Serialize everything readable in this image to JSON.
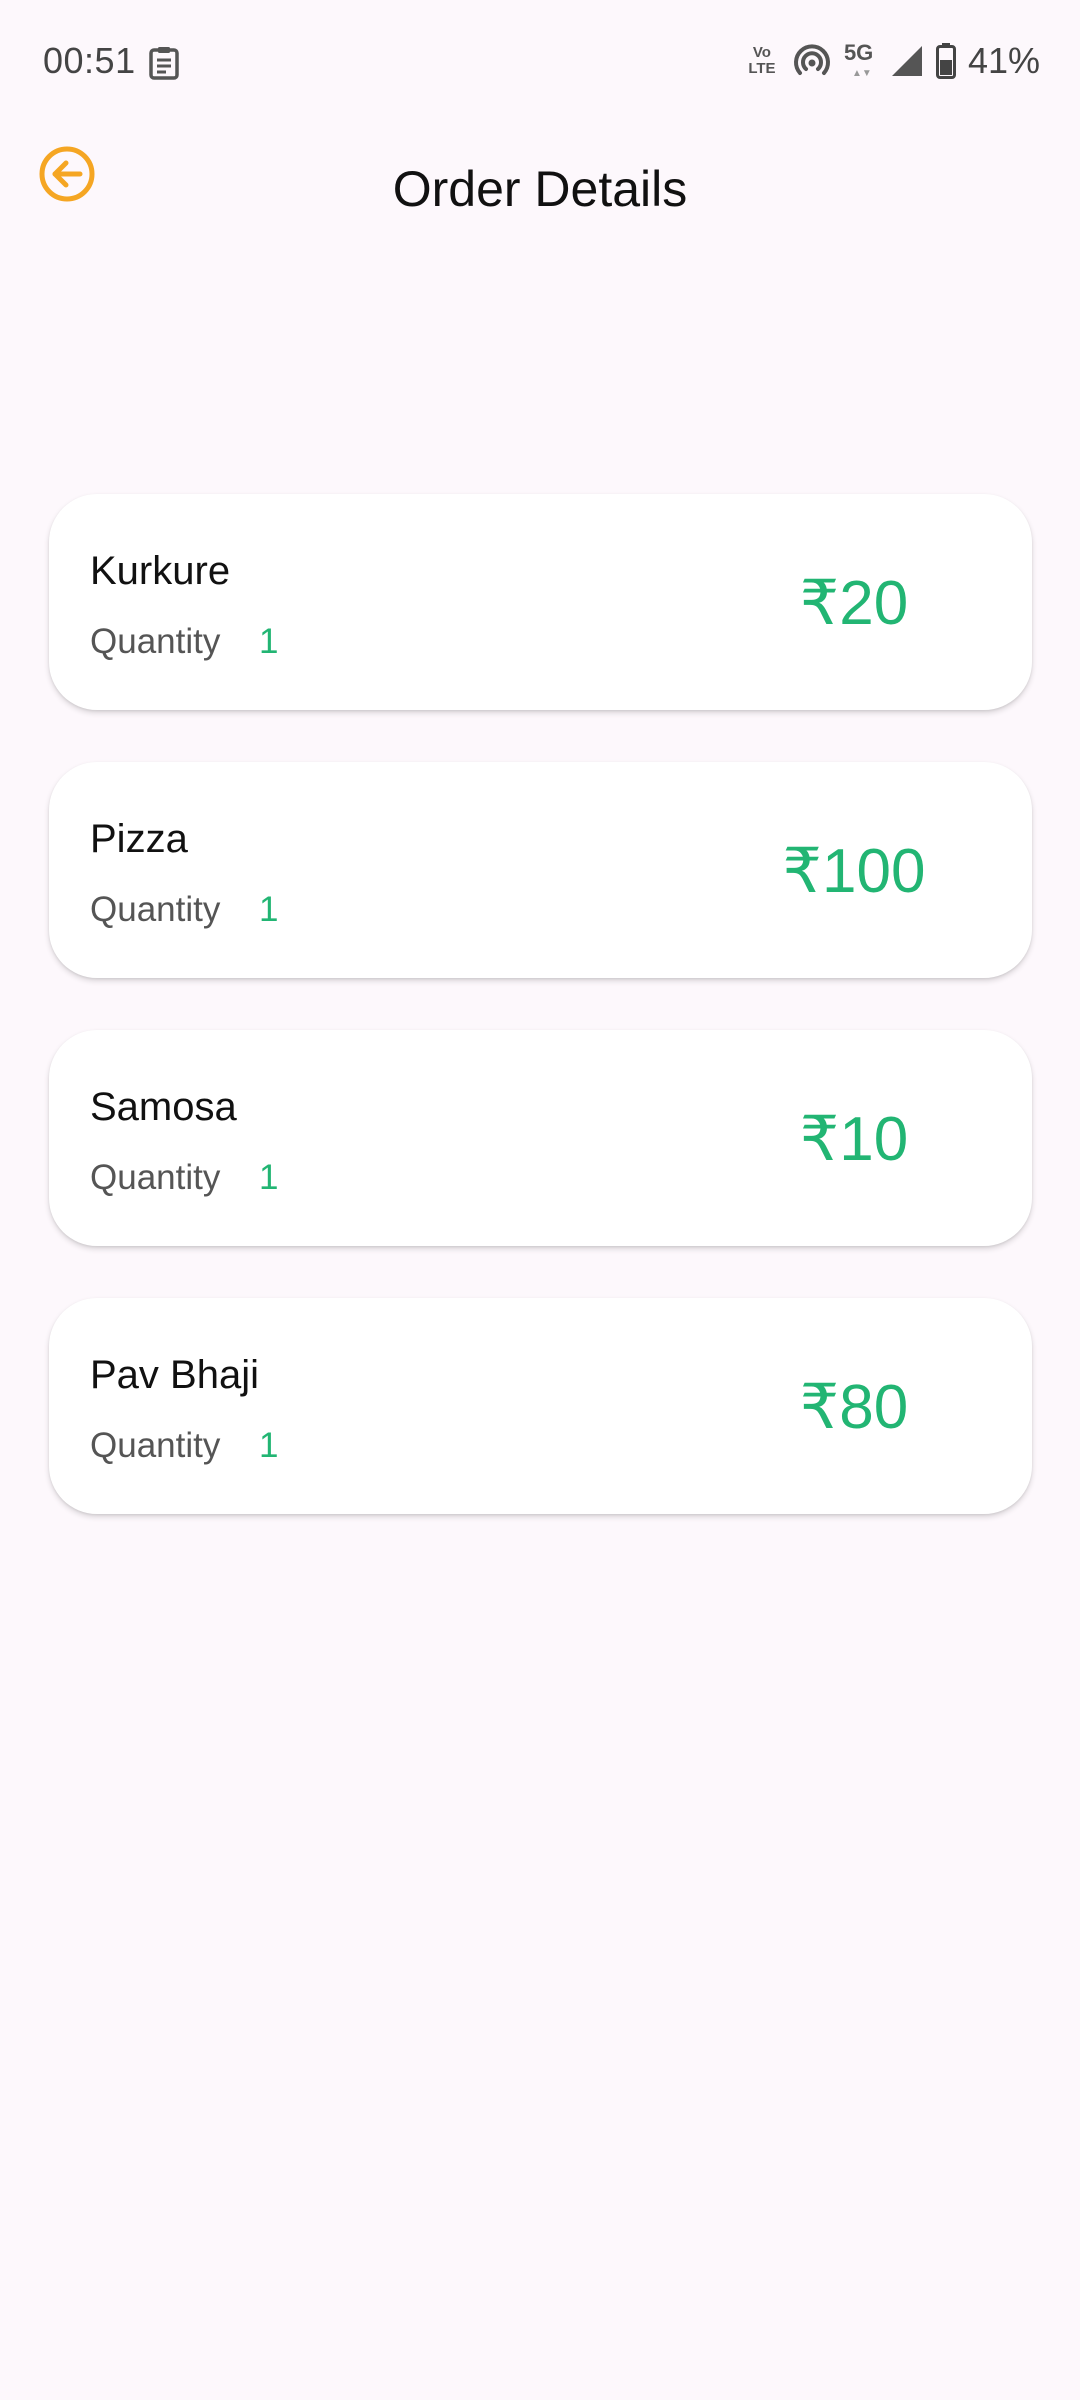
{
  "status_bar": {
    "time": "00:51",
    "volte_top": "Vo",
    "volte_bottom": "LTE",
    "network": "5G",
    "battery": "41%"
  },
  "header": {
    "title": "Order Details",
    "back_icon": "arrow-left-circle-icon",
    "accent_color": "#f5a623"
  },
  "orders": [
    {
      "name": "Kurkure",
      "quantity_label": "Quantity",
      "quantity": "1",
      "price": "₹20"
    },
    {
      "name": "Pizza",
      "quantity_label": "Quantity",
      "quantity": "1",
      "price": "₹100"
    },
    {
      "name": "Samosa",
      "quantity_label": "Quantity",
      "quantity": "1",
      "price": "₹10"
    },
    {
      "name": "Pav Bhaji",
      "quantity_label": "Quantity",
      "quantity": "1",
      "price": "₹80"
    }
  ],
  "colors": {
    "price": "#22b573",
    "background": "#fdf8fc"
  }
}
